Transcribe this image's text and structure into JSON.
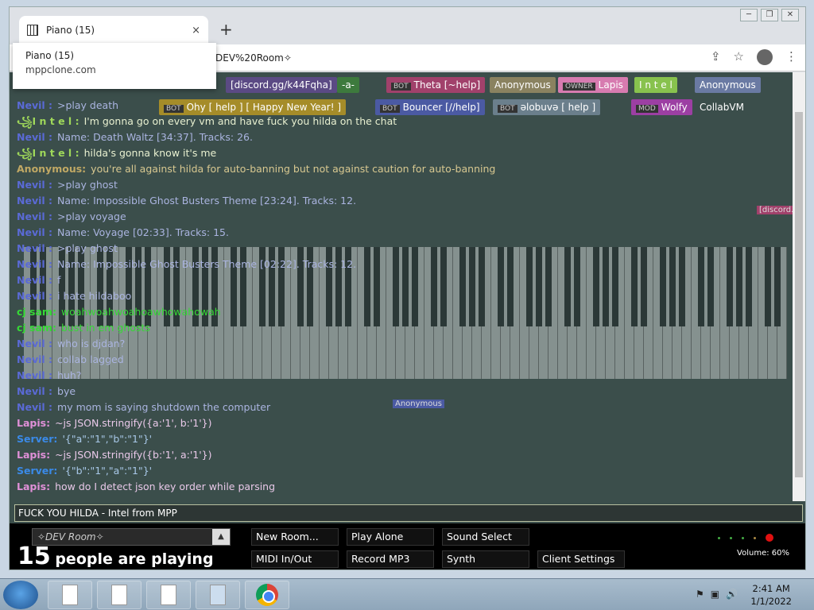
{
  "browser": {
    "tab_title": "Piano (15)",
    "tab_close": "×",
    "new_tab": "+",
    "window_controls": [
      "─",
      "❐",
      "✕"
    ],
    "url": "DEV%20Room✧",
    "tooltip": {
      "title": "Piano (15)",
      "url": "mppclone.com"
    },
    "toolbar_icons": [
      "share-icon",
      "star-icon",
      "profile-icon",
      "menu-icon"
    ]
  },
  "namebar": [
    {
      "label": "[discord.gg/k44Fqha]",
      "color": "#5b4a84"
    },
    {
      "label": "-a-",
      "color": "#3d7a3d"
    },
    {
      "label": "Theta [~help]",
      "badge": "BOT",
      "color": "#a1416b"
    },
    {
      "label": "Anonymous",
      "color": "#8a8260"
    },
    {
      "label": "Lapis",
      "badge": "OWNER",
      "color": "#d77bb0"
    },
    {
      "label": "I n t e l",
      "color": "#88c24e"
    },
    {
      "label": "Anonymous",
      "color": "#6a7aa3"
    },
    {
      "label": "Ohy [ help ] [ Happy New Year! ]",
      "badge": "BOT",
      "color": "#a58c29"
    },
    {
      "label": "Bouncer [//help]",
      "badge": "BOT",
      "color": "#4b5aa3"
    },
    {
      "label": "ǝlobuvǝ [ help ]",
      "badge": "BOT",
      "color": "#6b7f8c"
    },
    {
      "label": "Wolfy",
      "badge": "MOD",
      "color": "#9c3fa3"
    },
    {
      "label": "CollabVM",
      "color": "#3b4e4b"
    }
  ],
  "chat": [
    {
      "name": "Nevil :",
      "color": "#5a6ad6",
      "text": ">play death"
    },
    {
      "name": "꧁I n t e l :",
      "color": "#9fd85a",
      "text": "I'm gonna go on every vm and have fuck you hilda on the chat",
      "textcolor": "#e8f0d0"
    },
    {
      "name": "Nevil :",
      "color": "#5a6ad6",
      "text": "Name: Death Waltz [34:37]. Tracks: 26."
    },
    {
      "name": "꧁I n t e l :",
      "color": "#9fd85a",
      "text": "hilda's gonna know it's me",
      "textcolor": "#e8f0d0"
    },
    {
      "name": "Anonymous:",
      "color": "#c0a864",
      "text": "you're all against hilda for auto-banning but not against caution for auto-banning",
      "textcolor": "#d8c890"
    },
    {
      "name": "Nevil :",
      "color": "#5a6ad6",
      "text": ">play ghost"
    },
    {
      "name": "Nevil :",
      "color": "#5a6ad6",
      "text": "Name: Impossible Ghost Busters Theme [23:24]. Tracks: 12."
    },
    {
      "name": "Nevil :",
      "color": "#5a6ad6",
      "text": ">play voyage"
    },
    {
      "name": "Nevil :",
      "color": "#5a6ad6",
      "text": "Name: Voyage [02:33]. Tracks: 15."
    },
    {
      "name": "Nevil :",
      "color": "#5a6ad6",
      "text": ">play ghost"
    },
    {
      "name": "Nevil :",
      "color": "#5a6ad6",
      "text": "Name: Impossible Ghost Busters Theme [02:22]. Tracks: 12."
    },
    {
      "name": "Nevil :",
      "color": "#5a6ad6",
      "text": "f"
    },
    {
      "name": "Nevil :",
      "color": "#5a6ad6",
      "text": "i hate hildaboo"
    },
    {
      "name": "cj sam:",
      "color": "#36d836",
      "text": "woahwoahwoahoawhowahowah",
      "textcolor": "#36d836"
    },
    {
      "name": "cj sam:",
      "color": "#36d836",
      "text": "bust in em ghosts",
      "textcolor": "#36d836"
    },
    {
      "name": "Nevil :",
      "color": "#5a6ad6",
      "text": "who is djdan?"
    },
    {
      "name": "Nevil :",
      "color": "#5a6ad6",
      "text": "collab lagged"
    },
    {
      "name": "Nevil :",
      "color": "#5a6ad6",
      "text": "huh?"
    },
    {
      "name": "Nevil :",
      "color": "#5a6ad6",
      "text": "bye"
    },
    {
      "name": "Nevil :",
      "color": "#5a6ad6",
      "text": "my mom is saying shutdown the computer"
    },
    {
      "name": "Lapis:",
      "color": "#e090d8",
      "text": "~js JSON.stringify({a:'1', b:'1'})",
      "textcolor": "#e8c8e8"
    },
    {
      "name": "Server:",
      "color": "#3a8ae8",
      "text": "'{\"a\":\"1\",\"b\":\"1\"}'",
      "textcolor": "#a8c8e8"
    },
    {
      "name": "Lapis:",
      "color": "#e090d8",
      "text": "~js JSON.stringify({b:'1', a:'1'})",
      "textcolor": "#e8c8e8"
    },
    {
      "name": "Server:",
      "color": "#3a8ae8",
      "text": "'{\"b\":\"1\",\"a\":\"1\"}'",
      "textcolor": "#a8c8e8"
    },
    {
      "name": "Lapis:",
      "color": "#e090d8",
      "text": "how do I detect json key order while parsing",
      "textcolor": "#e8c8e8"
    }
  ],
  "chat_input": "FUCK YOU HILDA - Intel from MPP",
  "room_select": "✧DEV Room✧",
  "people": {
    "count": "15",
    "label": "people are playing"
  },
  "buttons": [
    "New Room...",
    "Play Alone",
    "Sound Select",
    "MIDI In/Out",
    "Record MP3",
    "Synth",
    "Client Settings"
  ],
  "volume_label": "Volume: 60%",
  "floating_tags": [
    "Anonymous",
    "cursor",
    "[discord..."
  ],
  "taskbar": {
    "time": "2:41 AM",
    "date": "1/1/2022"
  }
}
